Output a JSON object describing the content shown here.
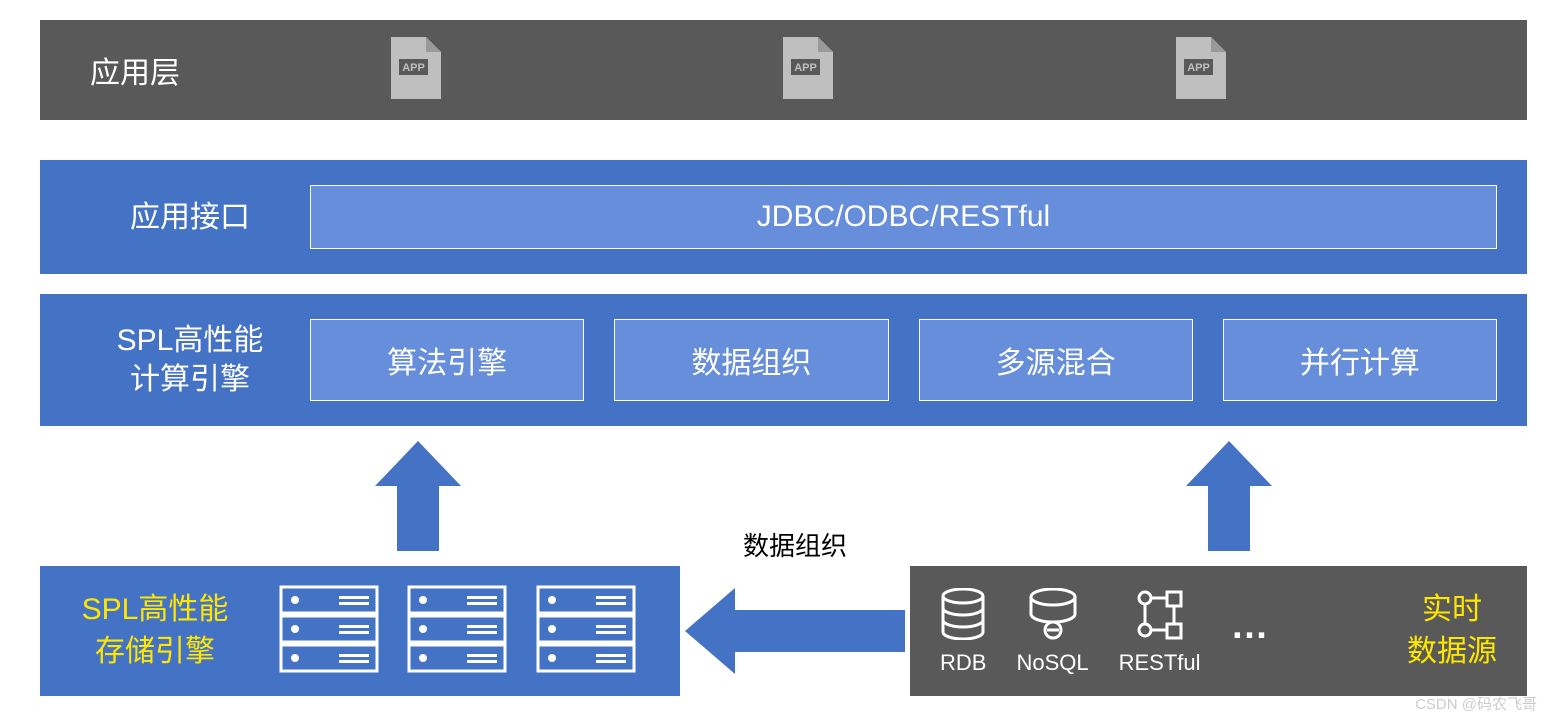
{
  "app_layer": {
    "label": "应用层",
    "icon_name": "APP"
  },
  "interface_layer": {
    "label": "应用接口",
    "protocol": "JDBC/ODBC/RESTful"
  },
  "engine_layer": {
    "label_line1": "SPL高性能",
    "label_line2": "计算引擎",
    "modules": [
      "算法引擎",
      "数据组织",
      "多源混合",
      "并行计算"
    ]
  },
  "flow_label": "数据组织",
  "storage_layer": {
    "label_line1": "SPL高性能",
    "label_line2": "存储引擎"
  },
  "realtime_source": {
    "label_line1": "实时",
    "label_line2": "数据源",
    "sources": [
      "RDB",
      "NoSQL",
      "RESTful"
    ],
    "ellipsis": "…"
  },
  "watermark": "CSDN @码农飞哥"
}
